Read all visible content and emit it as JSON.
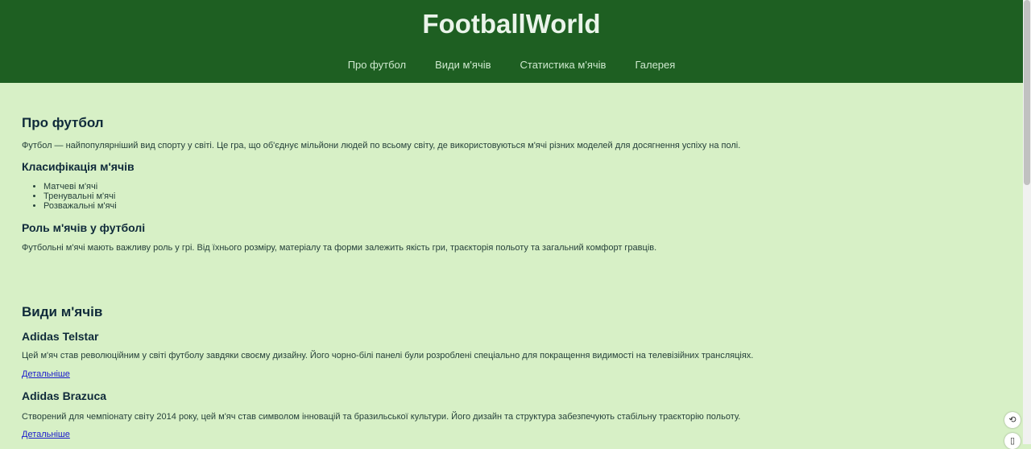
{
  "site": {
    "title": "FootballWorld"
  },
  "nav": [
    {
      "label": "Про футбол"
    },
    {
      "label": "Види м'ячів"
    },
    {
      "label": "Статистика м'ячів"
    },
    {
      "label": "Галерея"
    }
  ],
  "about": {
    "heading": "Про футбол",
    "intro": "Футбол — найпопулярніший вид спорту у світі. Це гра, що об'єднує мільйони людей по всьому світу, де використовуються м'ячі різних моделей для досягнення успіху на полі.",
    "classification_heading": "Класифікація м'ячів",
    "classification_items": [
      "Матчеві м'ячі",
      "Тренувальні м'ячі",
      "Розважальні м'ячі"
    ],
    "role_heading": "Роль м'ячів у футболі",
    "role_text": "Футбольні м'ячі мають важливу роль у грі. Від їхнього розміру, матеріалу та форми залежить якість гри, траєкторія польоту та загальний комфорт гравців."
  },
  "types": {
    "heading": "Види м'ячів",
    "balls": [
      {
        "name": "Adidas Telstar",
        "description": "Цей м'яч став революційним у світі футболу завдяки своєму дизайну. Його чорно-білі панелі були розроблені спеціально для покращення видимості на телевізійних трансляціях.",
        "link": "Детальніше"
      },
      {
        "name": "Adidas Brazuca",
        "description": "Створений для чемпіонату світу 2014 року, цей м'яч став символом інновацій та бразильської культури. Його дизайн та структура забезпечують стабільну траєкторію польоту.",
        "link": "Детальніше"
      }
    ]
  },
  "floating": {
    "icon1": "⟲",
    "icon2": "▯"
  }
}
